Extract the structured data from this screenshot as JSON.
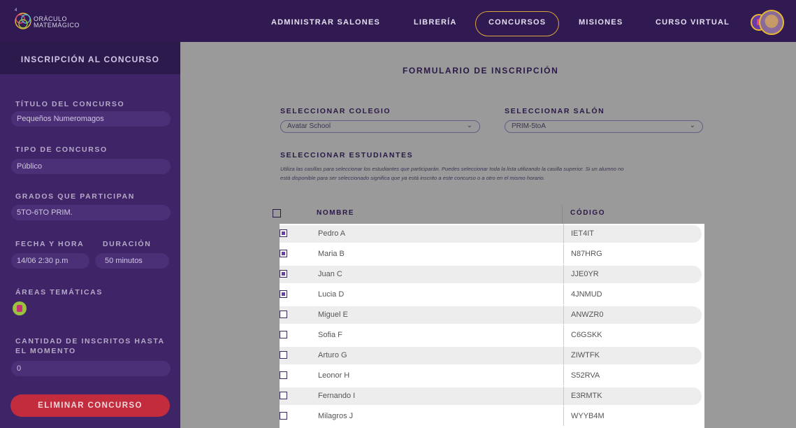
{
  "brand": {
    "line1": "ORÁCULO",
    "line2": "MATEMÁGICO"
  },
  "nav": [
    {
      "label": "ADMINISTRAR SALONES"
    },
    {
      "label": "LIBRERÍA"
    },
    {
      "label": "CONCURSOS",
      "active": true
    },
    {
      "label": "MISIONES"
    },
    {
      "label": "CURSO VIRTUAL"
    }
  ],
  "sidebar": {
    "header": "INSCRIPCIÓN AL CONCURSO",
    "title_label": "TÍTULO DEL CONCURSO",
    "title_value": "Pequeños Numeromagos",
    "type_label": "TIPO DE CONCURSO",
    "type_value": "Público",
    "grades_label": "GRADOS QUE PARTICIPAN",
    "grades_value": "5TO-6TO PRIM.",
    "datetime_label": "FECHA Y HORA",
    "datetime_value": "14/06 2:30 p.m",
    "duration_label": "DURACIÓN",
    "duration_value": "50 minutos",
    "areas_label": "ÁREAS TEMÁTICAS",
    "count_label_1": "CANTIDAD DE INSCRITOS HASTA",
    "count_label_2": "EL MOMENTO",
    "count_value": "0",
    "delete_label": "ELIMINAR CONCURSO"
  },
  "form": {
    "title": "FORMULARIO DE INSCRIPCIÓN",
    "school_label": "SELECCIONAR COLEGIO",
    "school_value": "Avatar School",
    "class_label": "SELECCIONAR SALÓN",
    "class_value": "PRIM-5toA",
    "students_label": "SELECCIONAR ESTUDIANTES",
    "instructions_1": "Utiliza las casillas para seleccionar los estudiantes que participarán. Puedes seleccionar toda la lista utilizando la casilla superior. Si un alumno no",
    "instructions_2": "está disponible para ser seleccionado significa que ya está inscrito a este concurso o a otro en el mismo horario.",
    "col_name": "NOMBRE",
    "col_code": "CÓDIGO"
  },
  "students": [
    {
      "name": "Pedro A",
      "code": "IET4IT",
      "checked": true
    },
    {
      "name": "Maria B",
      "code": "N87HRG",
      "checked": true
    },
    {
      "name": "Juan C",
      "code": "JJE0YR",
      "checked": true
    },
    {
      "name": "Lucia D",
      "code": "4JNMUD",
      "checked": true
    },
    {
      "name": "Miguel E",
      "code": "ANWZR0",
      "checked": false
    },
    {
      "name": "Sofia F",
      "code": "C6GSKK",
      "checked": false
    },
    {
      "name": "Arturo G",
      "code": "ZIWTFK",
      "checked": false
    },
    {
      "name": "Leonor H",
      "code": "S52RVA",
      "checked": false
    },
    {
      "name": "Fernando I",
      "code": "E3RMTK",
      "checked": false
    },
    {
      "name": "Milagros J",
      "code": "WYYB4M",
      "checked": false
    }
  ]
}
